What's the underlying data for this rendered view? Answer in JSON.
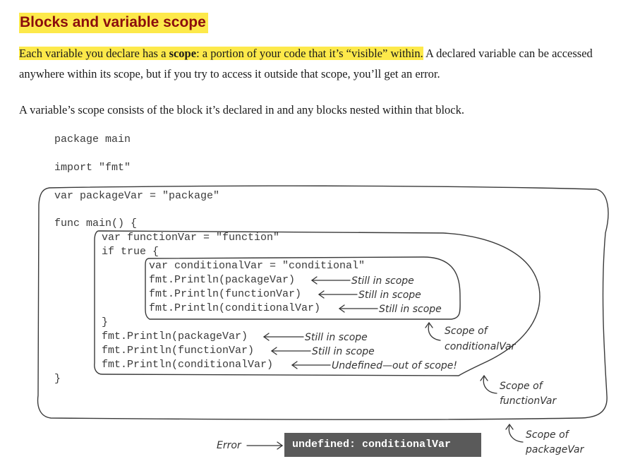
{
  "heading": "Blocks and variable scope",
  "intro": {
    "highlight_before": "Each variable you declare has a ",
    "highlight_bold": "scope",
    "highlight_after": ": a portion of your code that it’s “visible” within.",
    "rest": " A declared variable can be accessed anywhere within its scope, but if you try to access it outside that scope, you’ll get an error."
  },
  "rule_text": "A variable’s scope consists of the block it’s declared in and any blocks nested within that block.",
  "code_lines": [
    "package main",
    "import \"fmt\"",
    "var packageVar = \"package\"",
    "func main() {",
    "var functionVar = \"function\"",
    "if true {",
    "var conditionalVar = \"conditional\"",
    "fmt.Println(packageVar)",
    "fmt.Println(functionVar)",
    "fmt.Println(conditionalVar)",
    "}",
    "fmt.Println(packageVar)",
    "fmt.Println(functionVar)",
    "fmt.Println(conditionalVar)",
    "}"
  ],
  "annotations": {
    "still_in_scope": "Still in scope",
    "undefined_out_of_scope": "Undefined—out of scope!",
    "scope_conditional_line1": "Scope of",
    "scope_conditional_line2": "conditionalVar",
    "scope_function_line1": "Scope of",
    "scope_function_line2": "functionVar",
    "scope_package_line1": "Scope of",
    "scope_package_line2": "packageVar"
  },
  "error": {
    "label": "Error",
    "message": "undefined: conditionalVar"
  }
}
